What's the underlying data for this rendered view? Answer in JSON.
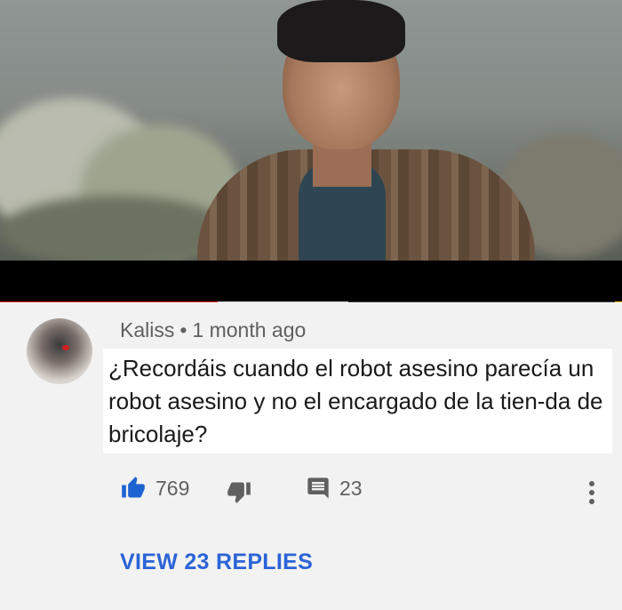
{
  "video": {
    "progress_played_pct": 35,
    "progress_buffered_pct": 56
  },
  "comment": {
    "author": "Kaliss",
    "separator": "•",
    "time": "1 month ago",
    "text": "¿Recordáis cuando el robot asesino parecía un robot asesino y no el encargado de la tien-da de bricolaje?",
    "likes": "769",
    "reply_count": "23",
    "view_replies_label": "VIEW 23 REPLIES"
  },
  "icons": {
    "like": "thumbs-up-icon",
    "dislike": "thumbs-down-icon",
    "reply": "comment-icon",
    "more": "more-vert-icon"
  },
  "colors": {
    "like_active": "#1e63d2",
    "link": "#2b64d6",
    "progress": "#e52d27"
  }
}
